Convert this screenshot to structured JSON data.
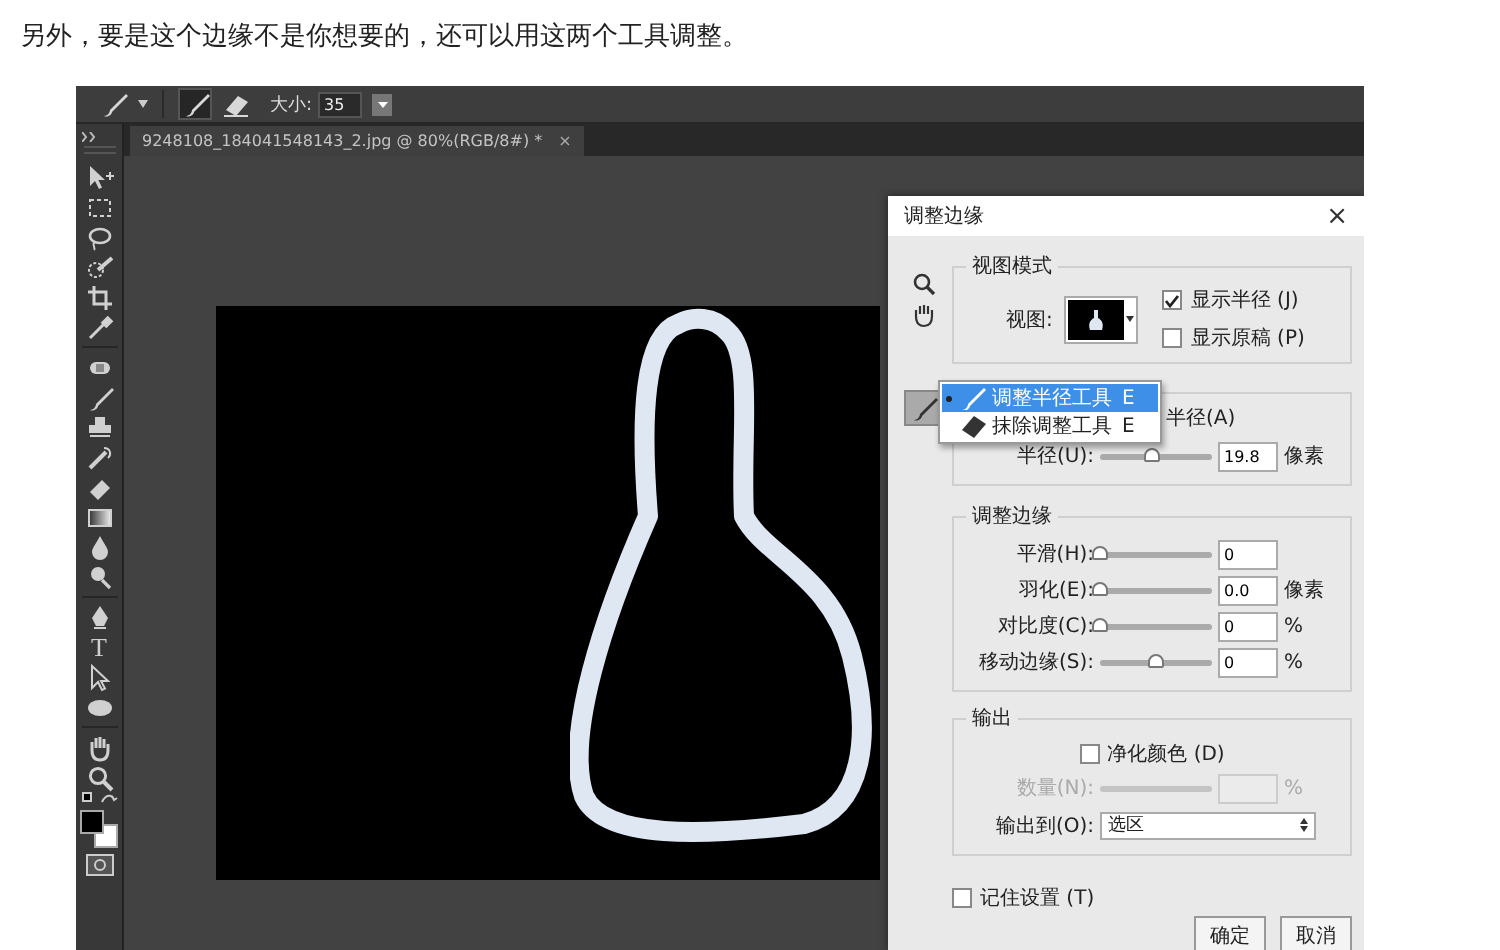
{
  "caption": "另外，要是这个边缘不是你想要的，还可以用这两个工具调整。",
  "options_bar": {
    "tools": [
      {
        "selected": true
      },
      {
        "selected": false
      }
    ],
    "size_label": "大小:",
    "size_value": "35"
  },
  "toolbar": {
    "type_tool": "T"
  },
  "document_tab": {
    "title": "9248108_184041548143_2.jpg @ 80%(RGB/8#) *",
    "close": "×"
  },
  "dialog": {
    "title": "调整边缘",
    "close": "×",
    "view_mode": {
      "legend": "视图模式",
      "view_label": "视图:",
      "show_radius": {
        "label": "显示半径 (J)",
        "checked": true
      },
      "show_original": {
        "label": "显示原稿 (P)",
        "checked": false
      }
    },
    "edge_detection": {
      "partial_label": "半径(A)",
      "radius": {
        "label": "半径(U):",
        "level": 0.47,
        "value": "19.8",
        "unit": "像素"
      }
    },
    "tool_menu": [
      {
        "label": "调整半径工具",
        "shortcut": "E",
        "selected": true
      },
      {
        "label": "抹除调整工具",
        "shortcut": "E",
        "selected": false
      }
    ],
    "adjust_edge": {
      "legend": "调整边缘",
      "sliders": [
        {
          "label": "平滑(H):",
          "level": 0,
          "value": "0"
        },
        {
          "label": "羽化(E):",
          "level": 0,
          "value": "0.0",
          "unit": "像素"
        },
        {
          "label": "对比度(C):",
          "level": 0,
          "value": "0",
          "unit": "%"
        },
        {
          "label": "移动边缘(S):",
          "level": 0.5,
          "value": "0",
          "unit": "%"
        }
      ]
    },
    "output": {
      "legend": "输出",
      "decontaminate": {
        "label": "净化颜色 (D)",
        "checked": false
      },
      "amount": {
        "label": "数量(N):",
        "unit": "%",
        "disabled": true
      },
      "output_to": {
        "label": "输出到(O):",
        "value": "选区"
      }
    },
    "remember": {
      "label": "记住设置 (T)",
      "checked": false
    },
    "buttons": [
      "确定",
      "取消"
    ]
  }
}
